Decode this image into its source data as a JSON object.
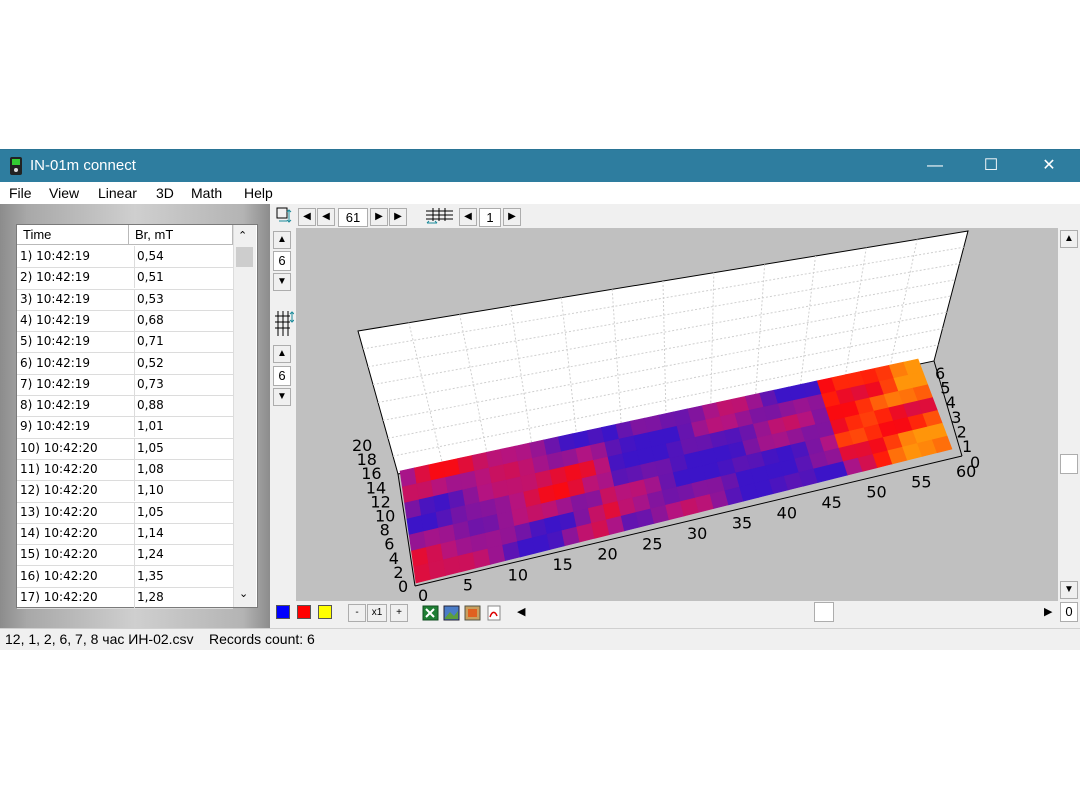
{
  "window": {
    "title": "IN-01m connect",
    "controls": {
      "minimize": "—",
      "maximize": "☐",
      "close": "✕"
    }
  },
  "menu": [
    "File",
    "View",
    "Linear",
    "3D",
    "Math",
    "Help"
  ],
  "table": {
    "columns": [
      "Time",
      "Br, mT"
    ],
    "rows": [
      [
        "1) 10:42:19",
        "0,54"
      ],
      [
        "2) 10:42:19",
        "0,51"
      ],
      [
        "3) 10:42:19",
        "0,53"
      ],
      [
        "4) 10:42:19",
        "0,68"
      ],
      [
        "5) 10:42:19",
        "0,71"
      ],
      [
        "6) 10:42:19",
        "0,52"
      ],
      [
        "7) 10:42:19",
        "0,73"
      ],
      [
        "8) 10:42:19",
        "0,88"
      ],
      [
        "9) 10:42:19",
        "1,01"
      ],
      [
        "10) 10:42:20",
        "1,05"
      ],
      [
        "11) 10:42:20",
        "1,08"
      ],
      [
        "12) 10:42:20",
        "1,10"
      ],
      [
        "13) 10:42:20",
        "1,05"
      ],
      [
        "14) 10:42:20",
        "1,14"
      ],
      [
        "15) 10:42:20",
        "1,24"
      ],
      [
        "16) 10:42:20",
        "1,35"
      ],
      [
        "17) 10:42:20",
        "1,28"
      ]
    ]
  },
  "toolbar": {
    "x_count": "61",
    "grid_count": "1",
    "y_count": "6",
    "z_count": "6",
    "zoom_minus": "-",
    "zoom_label": "x1",
    "zoom_plus": "+",
    "hscroll_value": "0"
  },
  "palette": [
    "#0000ff",
    "#ff0000",
    "#ffff00"
  ],
  "status": {
    "file": "12, 1, 2, 6, 7, 8 час ИН-02.csv",
    "records": "Records count: 6"
  },
  "plot": {
    "x_ticks": [
      "0",
      "5",
      "10",
      "15",
      "20",
      "25",
      "30",
      "35",
      "40",
      "45",
      "50",
      "55",
      "60"
    ],
    "y_ticks": [
      "0",
      "2",
      "4",
      "6",
      "8",
      "10",
      "12",
      "14",
      "16",
      "18",
      "20"
    ],
    "z_ticks": [
      "0",
      "1",
      "2",
      "3",
      "4",
      "5",
      "6"
    ]
  }
}
